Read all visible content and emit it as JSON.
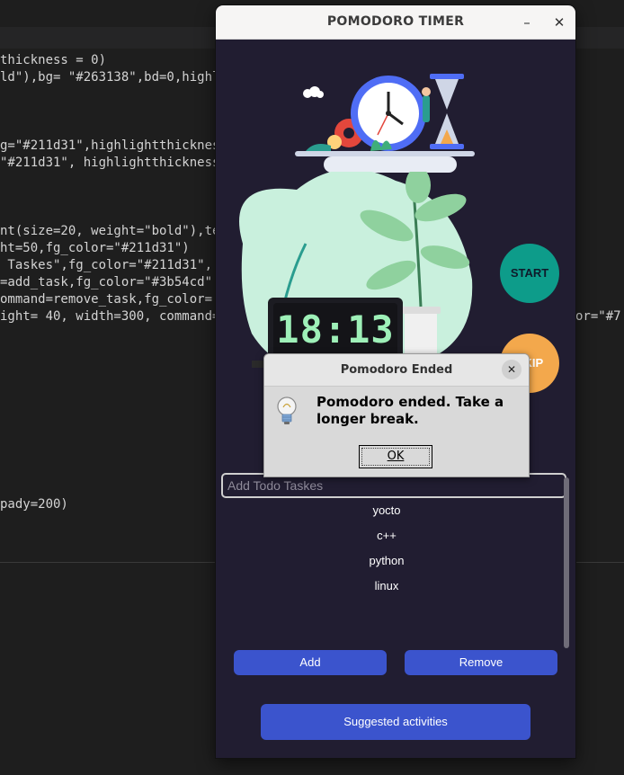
{
  "editor": {
    "lines": [
      "thickness = 0)",
      "ld\"),bg= \"#263138\",bd=0,highl",
      "g=\"#211d31\",highlightthickness",
      "\"#211d31\", highlightthickness",
      "nt(size=20, weight=\"bold\"),te",
      "ht=50,fg_color=\"#211d31\")",
      " Taskes\",fg_color=\"#211d31\",",
      "=add_task,fg_color=\"#3b54cd\"",
      "ommand=remove_task,fg_color=",
      "ight= 40, width=300, command=",
      "or=\"#7",
      "pady=200)"
    ]
  },
  "window": {
    "title": "POMODORO TIMER",
    "minimize_glyph": "–",
    "close_glyph": "✕"
  },
  "clock_display": "18:13",
  "start_label": "START",
  "skip_label": "SKIP",
  "task_input": {
    "placeholder": "Add Todo Taskes"
  },
  "tasks": [
    "yocto",
    "c++",
    "python",
    "linux"
  ],
  "add_label": "Add",
  "remove_label": "Remove",
  "suggest_label": "Suggested activities",
  "dialog": {
    "title": "Pomodoro Ended",
    "message": "Pomodoro ended. Take a longer break.",
    "ok_label": "OK",
    "close_glyph": "✕"
  },
  "colors": {
    "window_bg": "#211d31",
    "button_blue": "#3b54cd",
    "start_teal": "#0d9c8a",
    "skip_orange": "#f3a84c"
  }
}
